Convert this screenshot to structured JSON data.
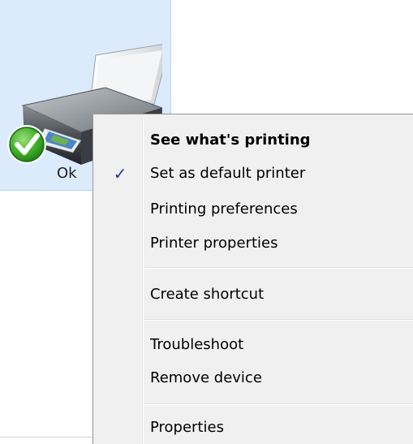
{
  "device": {
    "label": "Ok",
    "status_icon": "green-checkmark-icon",
    "icon": "printer-icon"
  },
  "colors": {
    "tile_background": "#dcebfc",
    "menu_background": "#f0f0f0",
    "check_color": "#1b3f8b",
    "status_green": "#3fae2a"
  },
  "context_menu": {
    "items": [
      {
        "label": "See what's printing",
        "bold": true,
        "checked": false
      },
      {
        "label": "Set as default printer",
        "bold": false,
        "checked": true,
        "check_glyph": "✓"
      },
      {
        "label": "Printing preferences",
        "bold": false,
        "checked": false
      },
      {
        "label": "Printer properties",
        "bold": false,
        "checked": false
      },
      {
        "label": "Create shortcut",
        "bold": false,
        "checked": false
      },
      {
        "label": "Troubleshoot",
        "bold": false,
        "checked": false
      },
      {
        "label": "Remove device",
        "bold": false,
        "checked": false
      },
      {
        "label": "Properties",
        "bold": false,
        "checked": false
      }
    ]
  }
}
